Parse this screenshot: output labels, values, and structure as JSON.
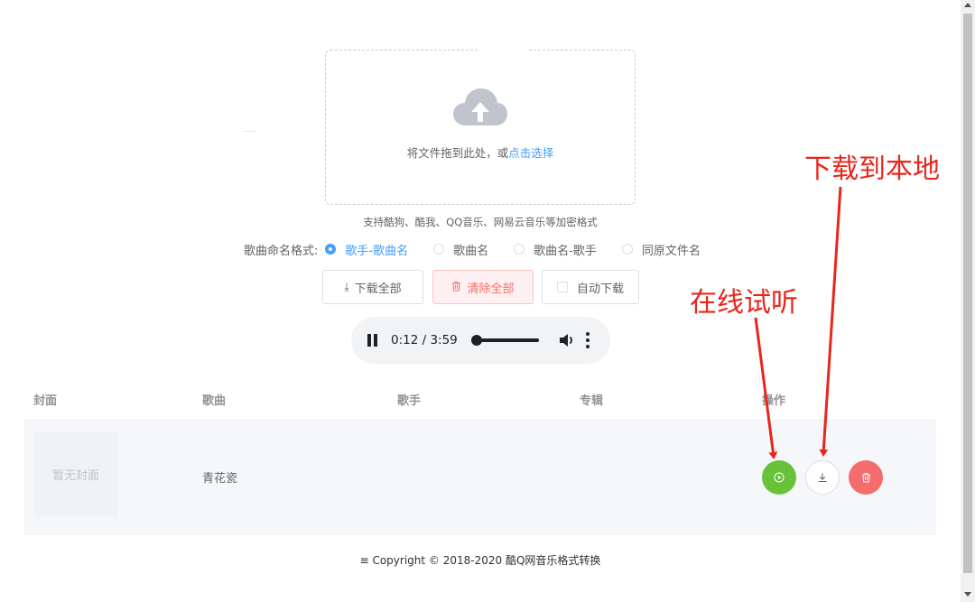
{
  "upload": {
    "text": "将文件拖到此处，或",
    "link": "点击选择",
    "tip": "支持酷狗、酷我、QQ音乐、网易云音乐等加密格式"
  },
  "naming": {
    "label": "歌曲命名格式:",
    "options": [
      "歌手-歌曲名",
      "歌曲名",
      "歌曲名-歌手",
      "同原文件名"
    ],
    "selected_index": 0
  },
  "buttons": {
    "download_all": "下载全部",
    "clear_all": "清除全部",
    "auto_download": "自动下载"
  },
  "player": {
    "time": "0:12 / 3:59",
    "progress": 0.05
  },
  "table": {
    "headers": [
      "封面",
      "歌曲",
      "歌手",
      "专辑",
      "操作"
    ],
    "rows": [
      {
        "cover": "暂无封面",
        "song": "青花瓷",
        "singer": "",
        "album": ""
      }
    ]
  },
  "footer": {
    "copyright": "≡ Copyright © 2018-2020 酷Q网音乐格式转换"
  },
  "annotations": {
    "download_local": "下载到本地",
    "listen_online": "在线试听"
  },
  "colors": {
    "primary": "#409eff",
    "success": "#67c23a",
    "danger": "#f56c6c",
    "annotation": "#e8261c"
  },
  "icons": [
    "cloud-upload-icon",
    "download-icon",
    "trash-icon",
    "pause-icon",
    "volume-icon",
    "more-vert-icon",
    "play-circle-icon"
  ]
}
